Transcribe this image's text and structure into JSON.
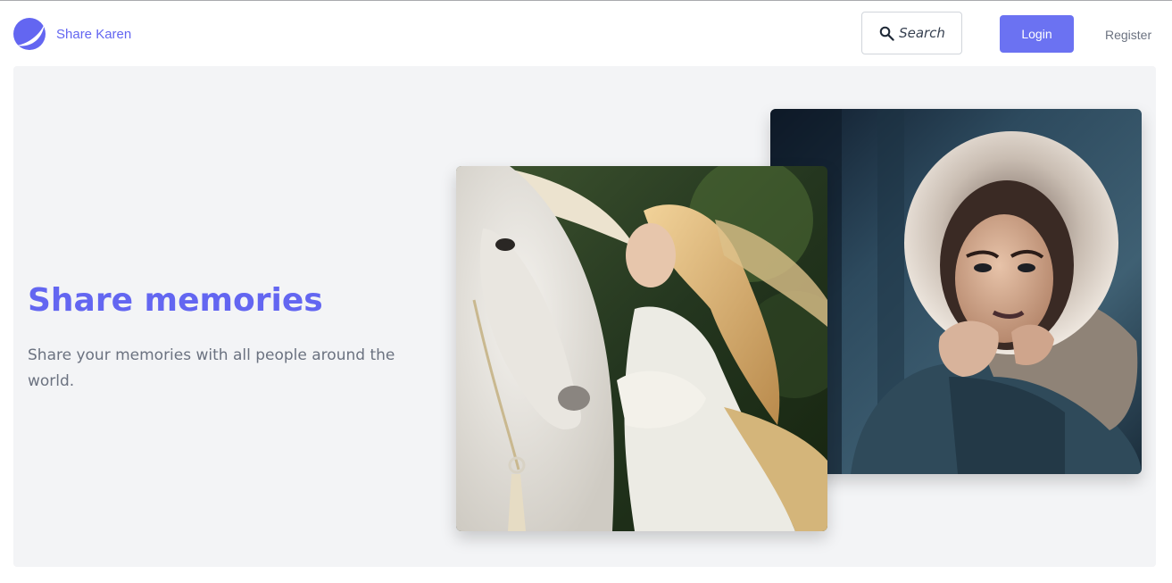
{
  "navbar": {
    "brand_name": "Share Karen",
    "search_label": "Search",
    "login_label": "Login",
    "register_label": "Register"
  },
  "hero": {
    "title": "Share memories",
    "text": "Share your memories with all people around the world."
  },
  "colors": {
    "accent": "#6366f1",
    "login_bg": "#6b72f2",
    "hero_bg": "#f3f4f6",
    "muted_text": "#6b7280"
  },
  "icons": {
    "brand": "crescent-logo-icon",
    "search": "magnifier-icon"
  }
}
